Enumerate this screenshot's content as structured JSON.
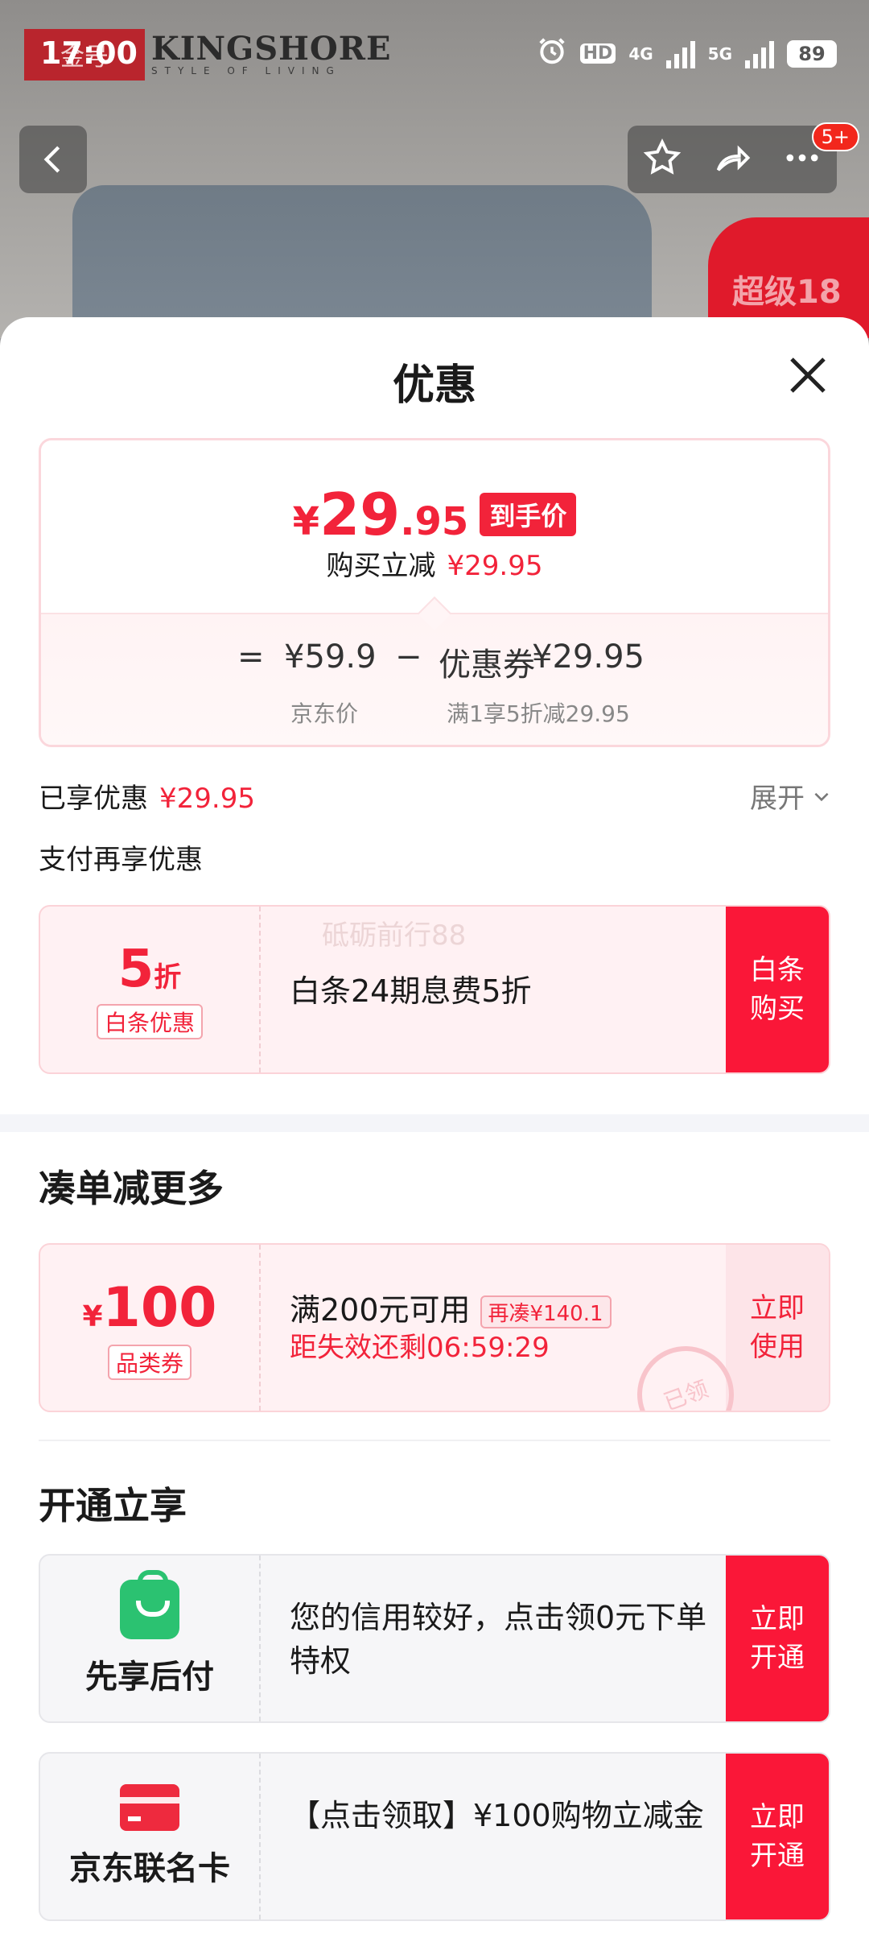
{
  "status_bar": {
    "time": "17:00",
    "hd_label": "HD",
    "network_4g": "4G",
    "network_5g": "5G",
    "battery": "89"
  },
  "product_bg": {
    "brand_box_text": "金号",
    "brand_name": "KINGSHORE",
    "brand_tagline": "STYLE OF LIVING",
    "cart_badge": "5+",
    "promo_text": "超级18"
  },
  "sheet": {
    "title": "优惠",
    "summary": {
      "currency": "¥",
      "price_int": "29",
      "price_dec": ".95",
      "price_tag": "到手价",
      "instant_label": "购买立减",
      "instant_value": "¥29.95",
      "eq": "=",
      "jd_price": "¥59.9",
      "minus": "−",
      "coupon_label": "优惠券",
      "coupon_value": "¥29.95",
      "jd_price_label": "京东价",
      "coupon_desc": "满1享5折减29.95"
    },
    "enjoyed_label": "已享优惠",
    "enjoyed_value": "¥29.95",
    "expand_label": "展开",
    "pay_again_label": "支付再享优惠",
    "baitiao": {
      "discount_num": "5",
      "discount_unit": "折",
      "tag": "白条优惠",
      "desc": "白条24期息费5折",
      "watermark": "砥砺前行88",
      "button_line1": "白条",
      "button_line2": "购买"
    },
    "more_section_title": "凑单减更多",
    "category_coupon": {
      "currency": "¥",
      "amount": "100",
      "tag": "品类券",
      "condition": "满200元可用",
      "need_more": "再凑¥140.1",
      "countdown": "距失效还剩06:59:29",
      "stamp": "已领",
      "button_line1": "立即",
      "button_line2": "使用"
    },
    "open_section_title": "开通立享",
    "services": [
      {
        "icon": "shopping-bag-icon",
        "name": "先享后付",
        "desc": "您的信用较好，点击领0元下单特权",
        "button_line1": "立即",
        "button_line2": "开通"
      },
      {
        "icon": "credit-card-icon",
        "name": "京东联名卡",
        "desc": "【点击领取】¥100购物立减金",
        "button_line1": "立即",
        "button_line2": "开通"
      }
    ]
  },
  "colors": {
    "accent_red": "#f2233a",
    "button_red": "#fa1738",
    "green": "#2bc271"
  }
}
